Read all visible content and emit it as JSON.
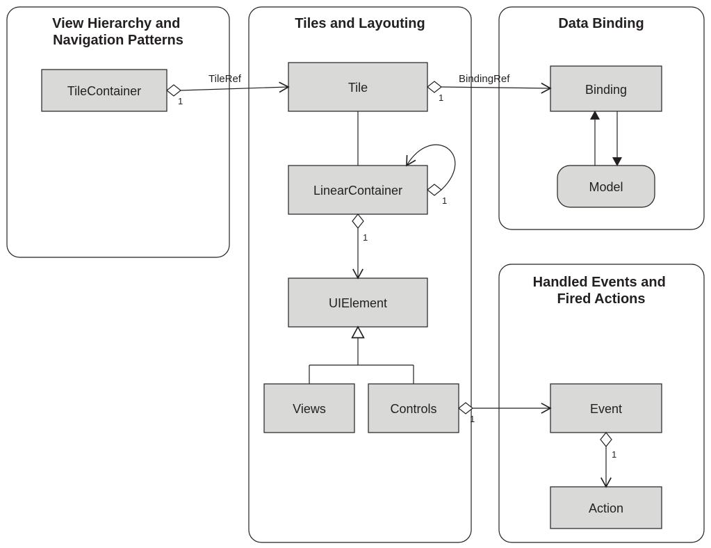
{
  "packages": {
    "viewnav": {
      "title": "View Hierarchy and\nNavigation Patterns"
    },
    "tiles": {
      "title": "Tiles and Layouting"
    },
    "binding": {
      "title": "Data Binding"
    },
    "events": {
      "title": "Handled Events and\nFired Actions"
    }
  },
  "classes": {
    "tilecontainer": {
      "label": "TileContainer"
    },
    "tile": {
      "label": "Tile"
    },
    "linearcontainer": {
      "label": "LinearContainer"
    },
    "uielement": {
      "label": "UIElement"
    },
    "views": {
      "label": "Views"
    },
    "controls": {
      "label": "Controls"
    },
    "binding": {
      "label": "Binding"
    },
    "model": {
      "label": "Model"
    },
    "event": {
      "label": "Event"
    },
    "action": {
      "label": "Action"
    }
  },
  "edges": {
    "tileref": {
      "label": "TileRef",
      "cardinality": "1"
    },
    "bindingref": {
      "label": "BindingRef",
      "cardinality": "1"
    },
    "linearself": {
      "cardinality": "1"
    },
    "uiagg": {
      "cardinality": "1"
    },
    "eventagg": {
      "cardinality": "1"
    },
    "actionagg": {
      "cardinality": "1"
    }
  }
}
